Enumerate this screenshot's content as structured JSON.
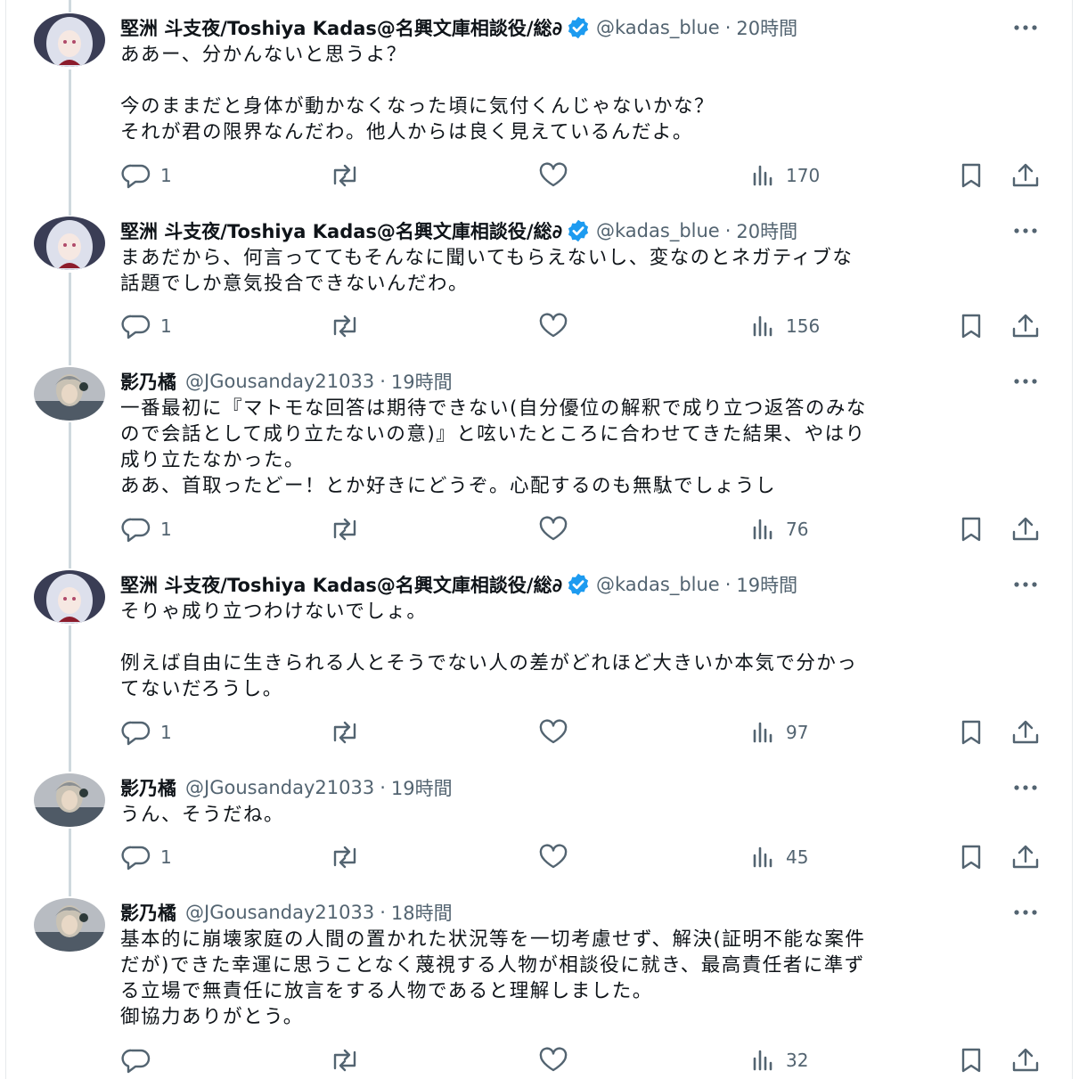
{
  "colors": {
    "text_primary": "#0f1419",
    "text_secondary": "#536471",
    "verified_blue": "#1d9bf0",
    "thread_line": "#cfd9de"
  },
  "tweets": [
    {
      "author": "堅洲 斗支夜/Toshiya Kadas@名興文庫相談役/総∂",
      "handle": "@kadas_blue",
      "verified": true,
      "time": "20時間",
      "lines": [
        "ああー、分かんないと思うよ？",
        "",
        "今のままだと身体が動かなくなった頃に気付くんじゃないかな？",
        "それが君の限界なんだわ。他人からは良く見えているんだよ。"
      ],
      "replies": "1",
      "views": "170"
    },
    {
      "author": "堅洲 斗支夜/Toshiya Kadas@名興文庫相談役/総∂",
      "handle": "@kadas_blue",
      "verified": true,
      "time": "20時間",
      "lines": [
        "まあだから、何言っててもそんなに聞いてもらえないし、変なのとネガティブな",
        "話題でしか意気投合できないんだわ。"
      ],
      "replies": "1",
      "views": "156"
    },
    {
      "author": "影乃橘",
      "handle": "@JGousanday21033",
      "verified": false,
      "time": "19時間",
      "lines": [
        "一番最初に『マトモな回答は期待できない(自分優位の解釈で成り立つ返答のみな",
        "ので会話として成り立たないの意)』と呟いたところに合わせてきた結果、やはり",
        "成り立たなかった。",
        "ああ、首取ったどー！とか好きにどうぞ。心配するのも無駄でしょうし"
      ],
      "replies": "1",
      "views": "76"
    },
    {
      "author": "堅洲 斗支夜/Toshiya Kadas@名興文庫相談役/総∂",
      "handle": "@kadas_blue",
      "verified": true,
      "time": "19時間",
      "lines": [
        "そりゃ成り立つわけないでしょ。",
        "",
        "例えば自由に生きられる人とそうでない人の差がどれほど大きいか本気で分かっ",
        "てないだろうし。"
      ],
      "replies": "1",
      "views": "97"
    },
    {
      "author": "影乃橘",
      "handle": "@JGousanday21033",
      "verified": false,
      "time": "19時間",
      "lines": [
        "うん、そうだね。"
      ],
      "replies": "1",
      "views": "45"
    },
    {
      "author": "影乃橘",
      "handle": "@JGousanday21033",
      "verified": false,
      "time": "18時間",
      "lines": [
        "基本的に崩壊家庭の人間の置かれた状況等を一切考慮せず、解決(証明不能な案件",
        "だが)できた幸運に思うことなく蔑視する人物が相談役に就き、最高責任者に準ず",
        "る立場で無責任に放言をする人物であると理解しました。",
        "御協力ありがとう。"
      ],
      "replies": "",
      "views": "32"
    }
  ]
}
